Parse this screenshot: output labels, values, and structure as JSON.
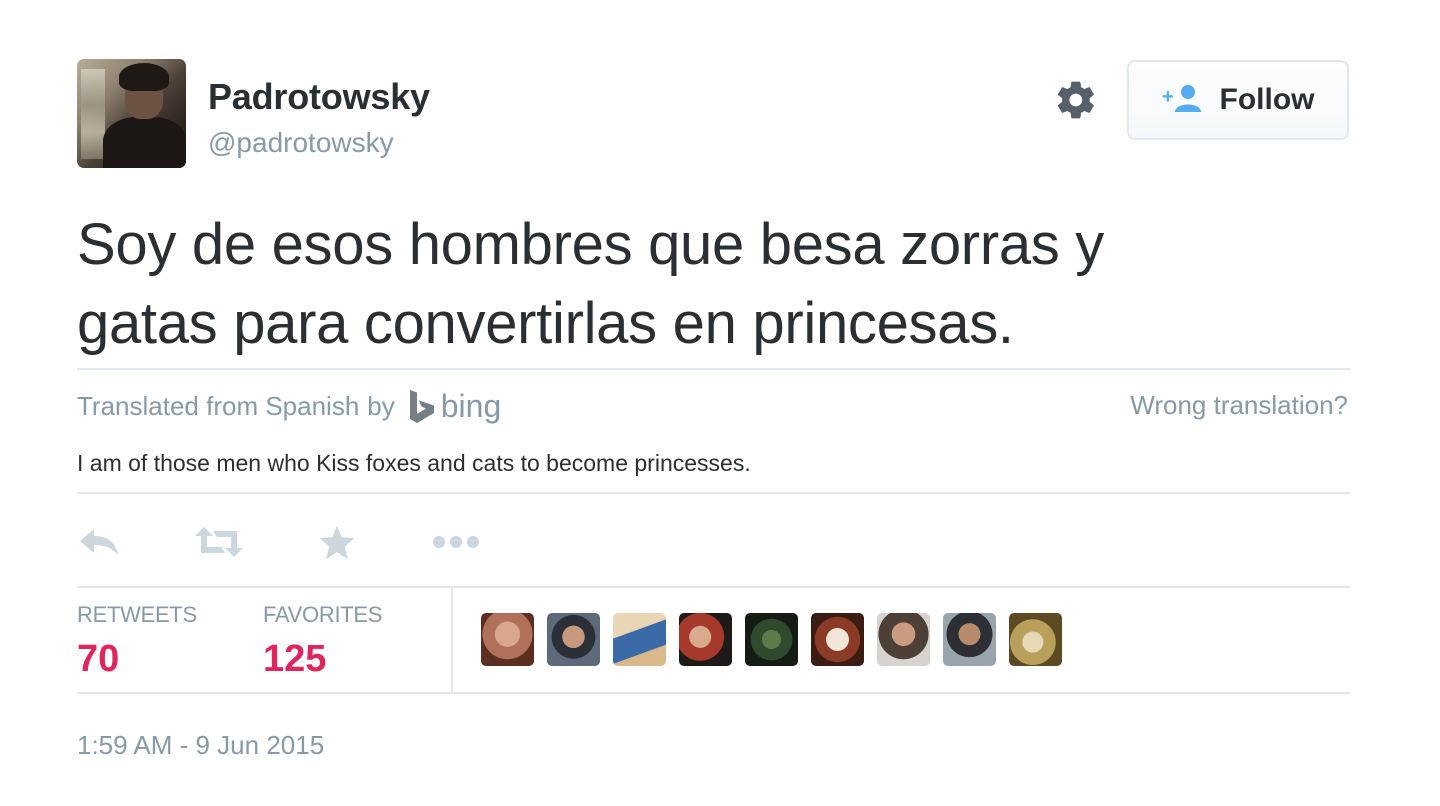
{
  "user": {
    "display_name": "Padrotowsky",
    "screen_name": "@padrotowsky"
  },
  "header": {
    "follow_label": "Follow",
    "gear_icon": "gear-icon",
    "follow_icon": "add-user-icon"
  },
  "tweet": {
    "text_line1": "Soy de esos hombres que besa zorras y",
    "text_line2": "gatas para convertirlas en princesas."
  },
  "translation": {
    "prefix": "Translated from Spanish",
    "by": "by",
    "provider": "bing",
    "wrong_link": "Wrong translation?",
    "text": "I am of those men who Kiss foxes and cats to become princesses."
  },
  "actions": [
    {
      "name": "reply",
      "icon": "reply-icon"
    },
    {
      "name": "retweet",
      "icon": "retweet-icon"
    },
    {
      "name": "favorite",
      "icon": "star-icon"
    },
    {
      "name": "more",
      "icon": "more-icon"
    }
  ],
  "stats": {
    "retweets_label": "RETWEETS",
    "retweets_value": "70",
    "favorites_label": "FAVORITES",
    "favorites_value": "125"
  },
  "favoriters": [
    {
      "name": "favoriter-1",
      "color": "#b0705a"
    },
    {
      "name": "favoriter-2",
      "color": "#5d6a7a"
    },
    {
      "name": "favoriter-3",
      "color": "#3a6aa8"
    },
    {
      "name": "favoriter-4",
      "color": "#a53a2c"
    },
    {
      "name": "favoriter-5",
      "color": "#2f4a2c"
    },
    {
      "name": "favoriter-6",
      "color": "#8a3a25"
    },
    {
      "name": "favoriter-7",
      "color": "#4d4036"
    },
    {
      "name": "favoriter-8",
      "color": "#9aa4ad"
    },
    {
      "name": "favoriter-9",
      "color": "#b9a05a"
    }
  ],
  "timestamp": "1:59 AM - 9 Jun 2015",
  "colors": {
    "text": "#292f33",
    "muted": "#8899a6",
    "accent_blue": "#55acee",
    "stat_red": "#e0245e",
    "divider": "#e1e8ed"
  }
}
